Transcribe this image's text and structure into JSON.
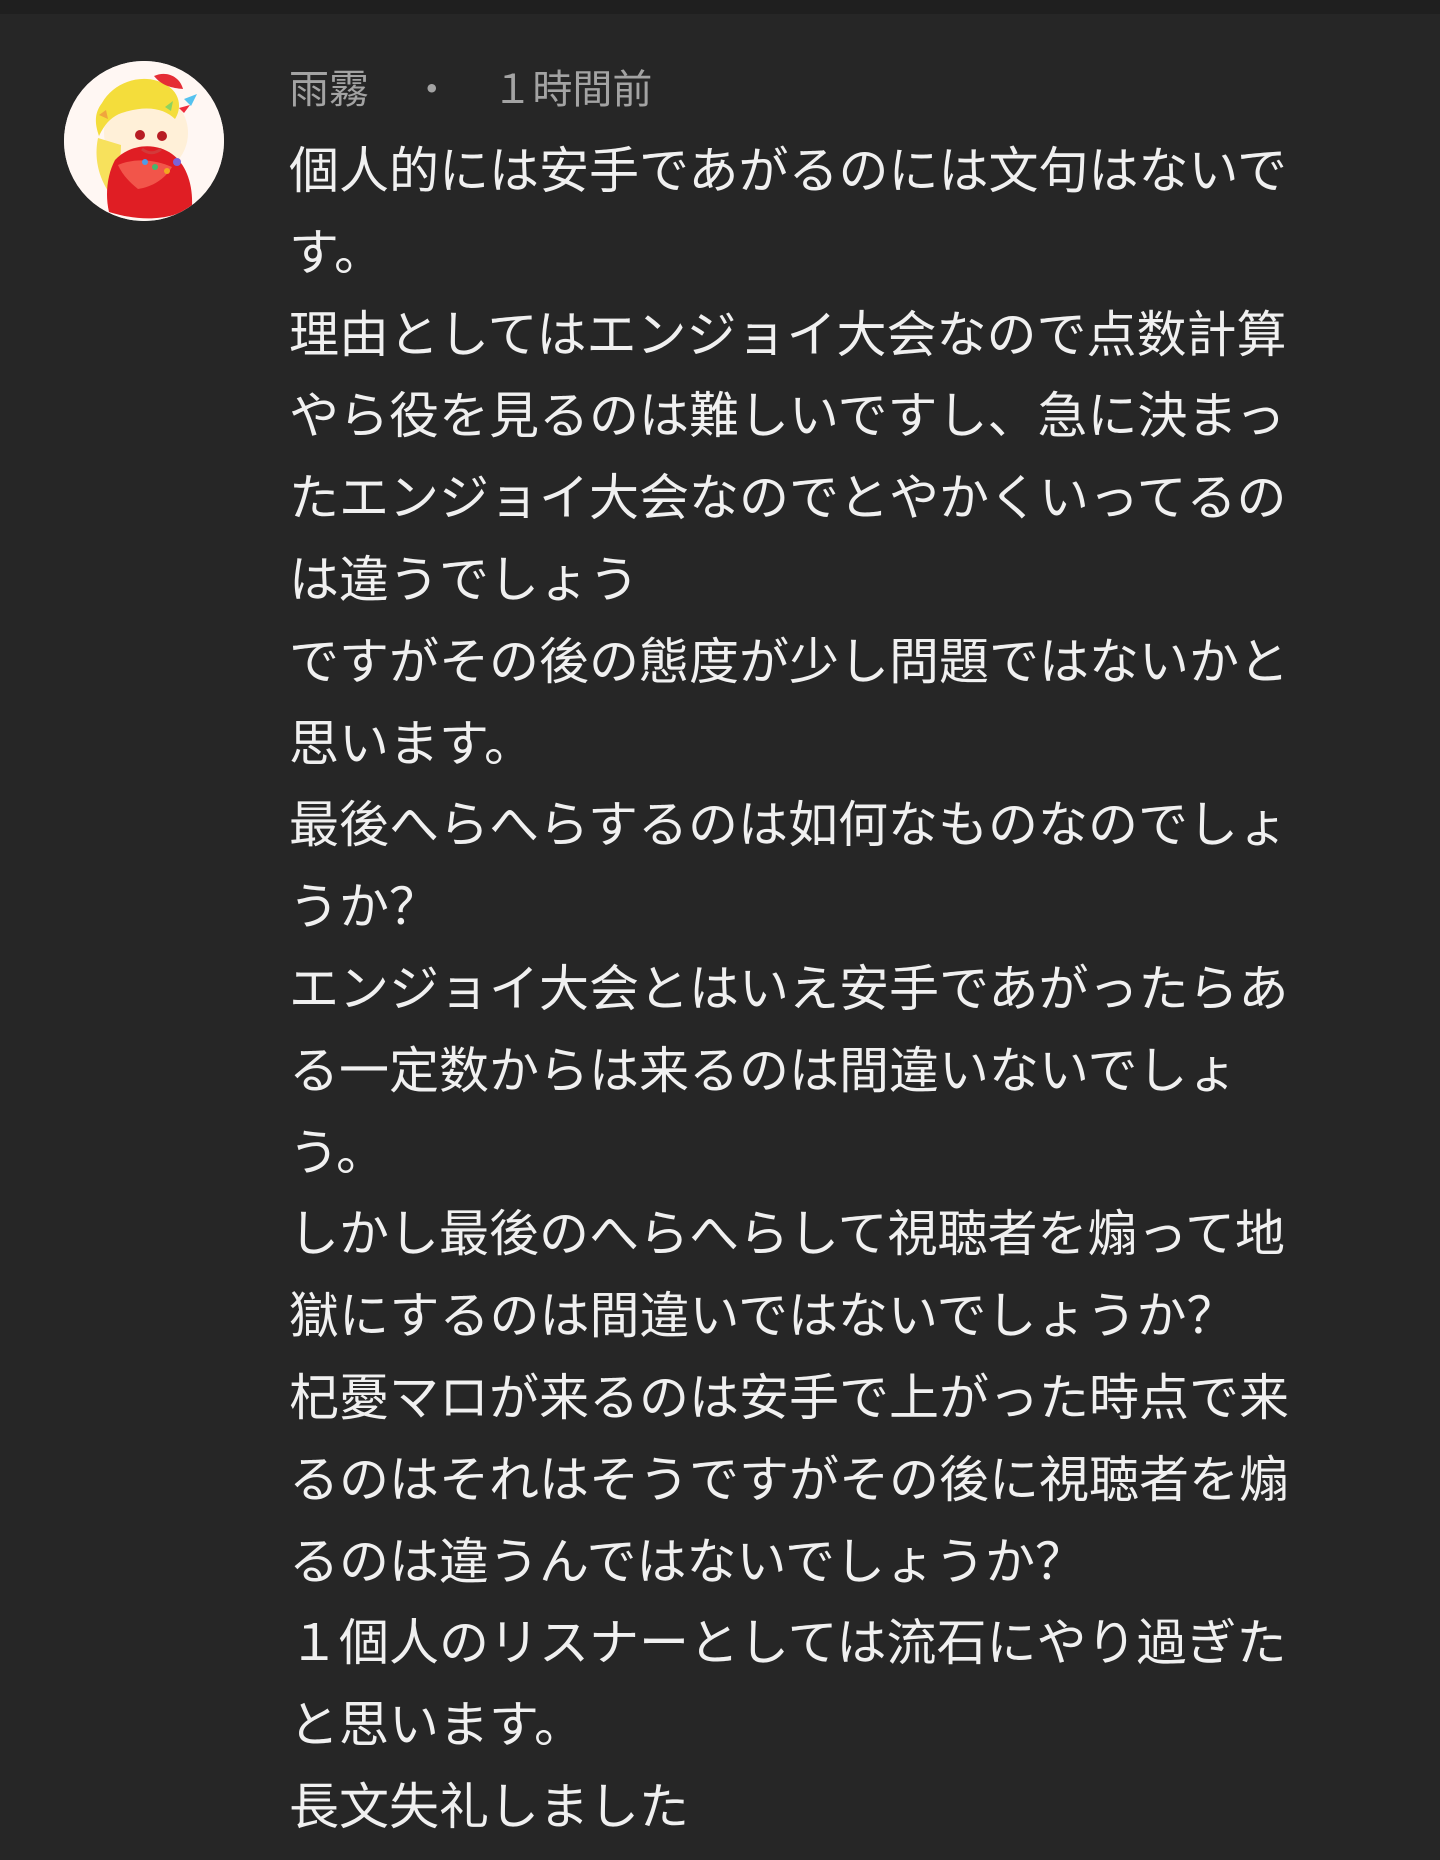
{
  "comment": {
    "author": "雨霧",
    "separator": "・",
    "timestamp": "１時間前",
    "avatar_icon": "anime-character-avatar",
    "text_lines": [
      "個人的には安手であがるのには文句はないで",
      "す。",
      "理由としてはエンジョイ大会なので点数計算",
      "やら役を見るのは難しいですし、急に決まっ",
      "たエンジョイ大会なのでとやかくいってるの",
      "は違うでしょう",
      "ですがその後の態度が少し問題ではないかと",
      "思います。",
      "最後へらへらするのは如何なものなのでしょ",
      "うか？",
      "エンジョイ大会とはいえ安手であがったらあ",
      "る一定数からは来るのは間違いないでしょ",
      "う。",
      "しかし最後のへらへらして視聴者を煽って地",
      "獄にするのは間違いではないでしょうか？",
      "杞憂マロが来るのは安手で上がった時点で来",
      "るのはそれはそうですがその後に視聴者を煽",
      "るのは違うんではないでしょうか？",
      "１個人のリスナーとしては流石にやり過ぎた",
      "と思います。",
      "長文失礼しました"
    ]
  },
  "colors": {
    "background": "#262626",
    "meta_text": "#a3a3a3",
    "body_text": "#f0f0f0"
  }
}
